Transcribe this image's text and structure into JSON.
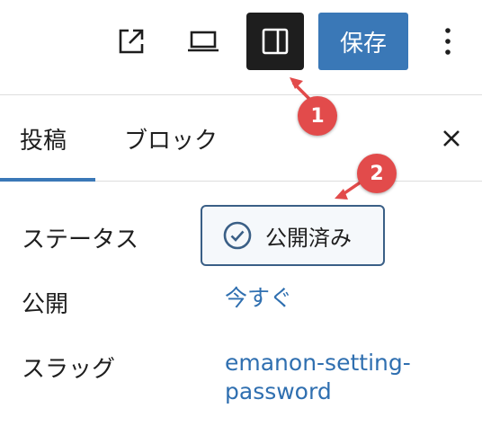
{
  "toolbar": {
    "external_icon": "external-link-icon",
    "preview_icon": "laptop-icon",
    "settings_icon": "sidebar-panel-icon",
    "save_label": "保存",
    "more_icon": "vertical-ellipsis-icon"
  },
  "tabs": [
    {
      "label": "投稿"
    },
    {
      "label": "ブロック"
    }
  ],
  "close_icon": "close-icon",
  "rows": {
    "status": {
      "label": "ステータス",
      "value": "公開済み",
      "icon": "check-circle-icon"
    },
    "publish": {
      "label": "公開",
      "value": "今すぐ"
    },
    "slug": {
      "label": "スラッグ",
      "value_line1": "emanon-setting-",
      "value_line2": "password"
    }
  },
  "annotations": [
    {
      "label": "1"
    },
    {
      "label": "2"
    }
  ],
  "colors": {
    "accent": "#3a78b7",
    "link": "#2f6fb0",
    "dark": "#1e1e1e",
    "annotation": "#e24b4b"
  }
}
